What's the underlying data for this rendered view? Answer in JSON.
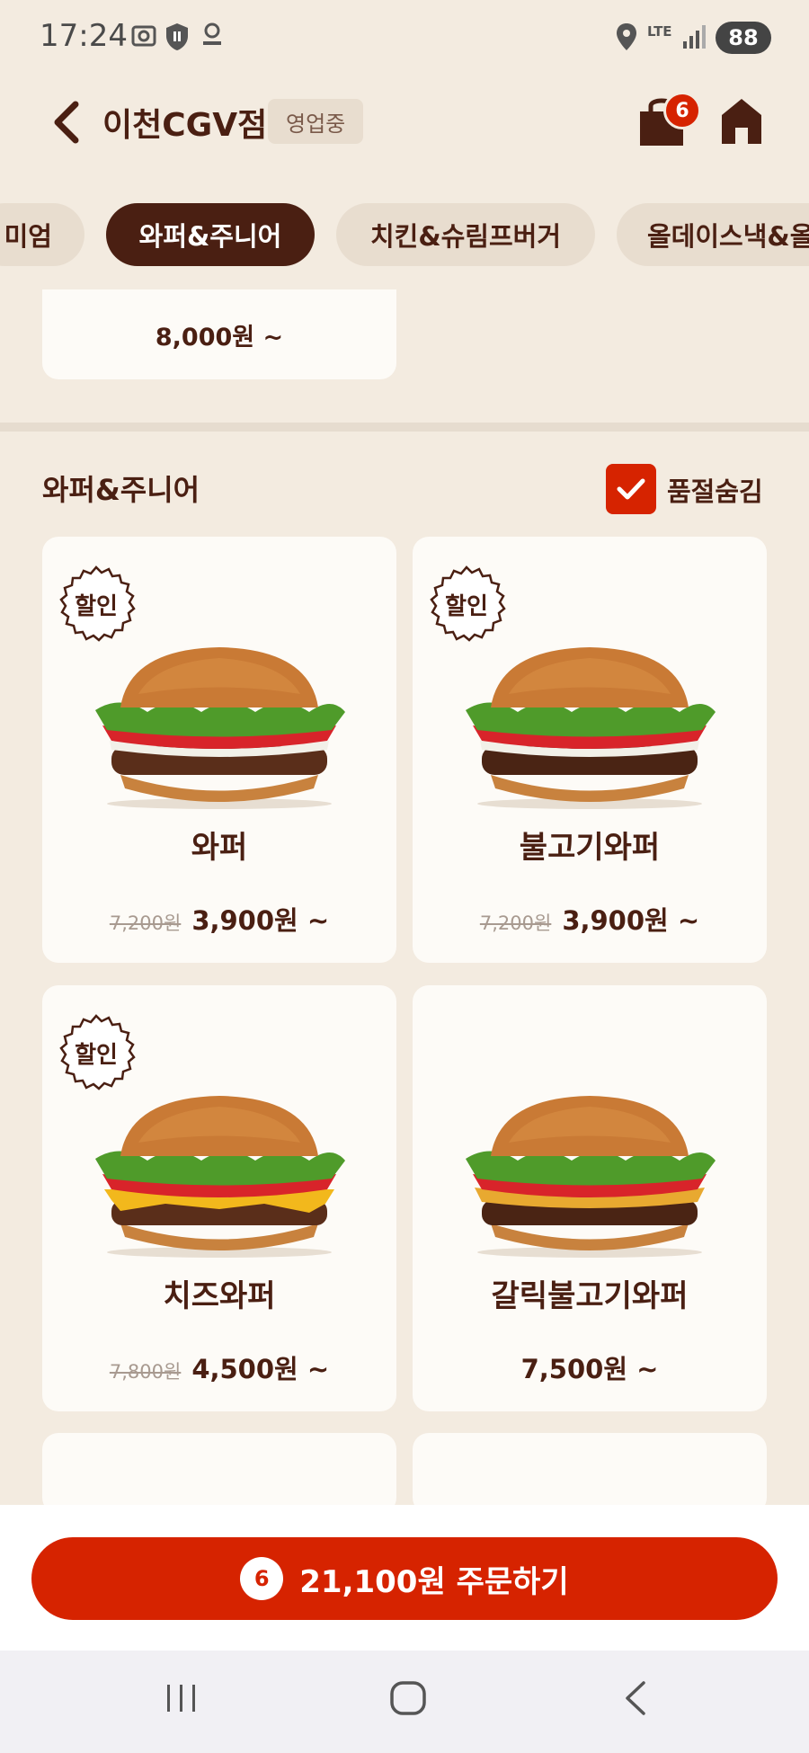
{
  "status_bar": {
    "time": "17:24",
    "battery": "88",
    "network": "LTE"
  },
  "header": {
    "store_name": "이천CGV점",
    "store_status": "영업중",
    "cart_count": "6"
  },
  "tabs": [
    {
      "label": "미엄",
      "active": false
    },
    {
      "label": "와퍼&주니어",
      "active": true
    },
    {
      "label": "치킨&슈림프버거",
      "active": false
    },
    {
      "label": "올데이스낵&올",
      "active": false
    }
  ],
  "prev_section": {
    "price": "8,000원 ~"
  },
  "section": {
    "title": "와퍼&주니어",
    "soldout_toggle_label": "품절숨김",
    "soldout_toggle_checked": true
  },
  "products": [
    {
      "name": "와퍼",
      "discount_badge": "할인",
      "old_price": "7,200원",
      "price": "3,900원 ~"
    },
    {
      "name": "불고기와퍼",
      "discount_badge": "할인",
      "old_price": "7,200원",
      "price": "3,900원 ~"
    },
    {
      "name": "치즈와퍼",
      "discount_badge": "할인",
      "old_price": "7,800원",
      "price": "4,500원 ~"
    },
    {
      "name": "갈릭불고기와퍼",
      "discount_badge": "",
      "old_price": "",
      "price": "7,500원 ~"
    }
  ],
  "order": {
    "count": "6",
    "label": "21,100원 주문하기"
  },
  "colors": {
    "brand_red": "#d62300",
    "brown": "#4a1f12",
    "background": "#f3ebe0",
    "card": "#fdfbf7"
  },
  "icons": [
    "back-icon",
    "bag-icon",
    "home-icon",
    "check-icon",
    "recent-apps-icon",
    "home-circle-icon",
    "nav-back-icon"
  ]
}
